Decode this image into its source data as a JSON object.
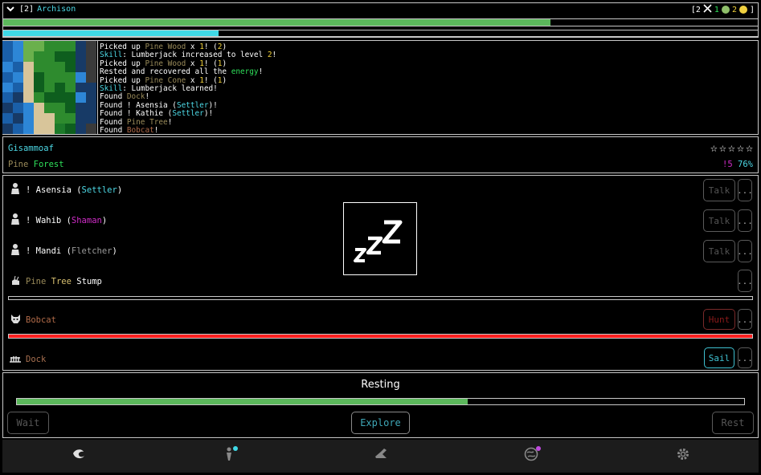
{
  "header": {
    "level_tag": "[2]",
    "character_name": "Archison",
    "right_stats": {
      "bracket_open": "[2",
      "icon_swords": "crossed-swords-icon",
      "green_count": "1",
      "yellow_count": "2",
      "bracket_close": "]"
    }
  },
  "bars": {
    "health_fraction": 0.725,
    "health_color": "#5cb85c",
    "energy_fraction": 0.285,
    "energy_color": "#3fd8e6"
  },
  "log": [
    [
      {
        "t": "Picked up "
      },
      {
        "t": "Pine Wood",
        "c": "wood"
      },
      {
        "t": " x "
      },
      {
        "t": "1",
        "c": "yellow"
      },
      {
        "t": "! ("
      },
      {
        "t": "2",
        "c": "yellow"
      },
      {
        "t": ")"
      }
    ],
    [
      {
        "t": "Skill",
        "c": "cyan"
      },
      {
        "t": ": Lumberjack increased to level "
      },
      {
        "t": "2",
        "c": "yellow"
      },
      {
        "t": "!"
      }
    ],
    [
      {
        "t": "Picked up "
      },
      {
        "t": "Pine Wood",
        "c": "wood"
      },
      {
        "t": " x "
      },
      {
        "t": "1",
        "c": "yellow"
      },
      {
        "t": "! ("
      },
      {
        "t": "1",
        "c": "yellow"
      },
      {
        "t": ")"
      }
    ],
    [
      {
        "t": "Rested and recovered all the "
      },
      {
        "t": "energy",
        "c": "green"
      },
      {
        "t": "!"
      }
    ],
    [
      {
        "t": "Picked up "
      },
      {
        "t": "Pine Cone",
        "c": "wood"
      },
      {
        "t": " x "
      },
      {
        "t": "1",
        "c": "yellow"
      },
      {
        "t": "! ("
      },
      {
        "t": "1",
        "c": "yellow"
      },
      {
        "t": ")"
      }
    ],
    [
      {
        "t": "Skill",
        "c": "cyan"
      },
      {
        "t": ": Lumberjack learned!"
      }
    ],
    [
      {
        "t": "Found "
      },
      {
        "t": "Dock",
        "c": "wood"
      },
      {
        "t": "!"
      }
    ],
    [
      {
        "t": "Found ! Asensia ("
      },
      {
        "t": "Settler",
        "c": "cyan"
      },
      {
        "t": ")!"
      }
    ],
    [
      {
        "t": "Found ! Kathie ("
      },
      {
        "t": "Settler",
        "c": "cyan"
      },
      {
        "t": ")!"
      }
    ],
    [
      {
        "t": "Found "
      },
      {
        "t": "Pine Tree",
        "c": "wood"
      },
      {
        "t": "!"
      }
    ],
    [
      {
        "t": "Found "
      },
      {
        "t": "Bobcat",
        "c": "brown"
      },
      {
        "t": "!"
      }
    ]
  ],
  "location": {
    "name": "Gisammoaf",
    "biome_word1": "Pine",
    "biome_word2": "Forest",
    "stars_total": 5,
    "stars_filled": 0,
    "stat_a": "!5",
    "stat_b": "76%"
  },
  "entities": [
    {
      "icon": "settler-icon",
      "prefix": "! ",
      "name": "Asensia",
      "role": "Settler",
      "role_color": "#4dd9e6",
      "action": "Talk"
    },
    {
      "icon": "shaman-icon",
      "prefix": "! ",
      "name": "Wahib",
      "role": "Shaman",
      "role_color": "#d02cc8",
      "action": "Talk"
    },
    {
      "icon": "fletcher-icon",
      "prefix": "! ",
      "name": "Mandi",
      "role": "Fletcher",
      "role_color": "#9a9a9a",
      "action": "Talk"
    }
  ],
  "pine_stump": {
    "w1": "Pine",
    "w2": "Tree",
    "w3": "Stump",
    "progress": 0.0
  },
  "bobcat": {
    "name": "Bobcat",
    "action": "Hunt",
    "health_fraction": 1.0,
    "health_color": "#ff2020"
  },
  "dock": {
    "name": "Dock",
    "action": "Sail"
  },
  "more_label": "...",
  "overlay": {
    "text": "zZZ"
  },
  "activity": {
    "title": "Resting",
    "progress_fraction": 0.62,
    "progress_color": "#5cb85c",
    "wait_label": "Wait",
    "explore_label": "Explore",
    "rest_label": "Rest"
  },
  "nav": [
    "map-icon",
    "character-icon",
    "crafting-icon",
    "world-icon",
    "gear-icon"
  ]
}
